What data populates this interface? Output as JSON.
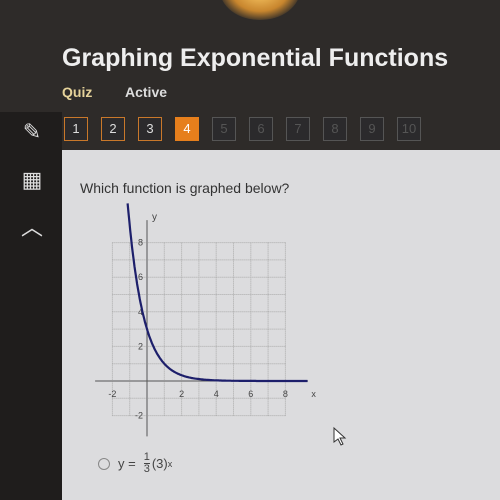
{
  "header": {
    "title": "Graphing Exponential Functions",
    "type": "Quiz",
    "status": "Active"
  },
  "tools": [
    {
      "icon": "pencil-icon"
    },
    {
      "icon": "calculator-icon"
    },
    {
      "icon": "collapse-up-icon"
    }
  ],
  "questions": [
    {
      "label": "1",
      "state": "answered"
    },
    {
      "label": "2",
      "state": "answered"
    },
    {
      "label": "3",
      "state": "answered"
    },
    {
      "label": "4",
      "state": "current"
    },
    {
      "label": "5",
      "state": "locked"
    },
    {
      "label": "6",
      "state": "locked"
    },
    {
      "label": "7",
      "state": "locked"
    },
    {
      "label": "8",
      "state": "locked"
    },
    {
      "label": "9",
      "state": "locked"
    },
    {
      "label": "10",
      "state": "locked"
    }
  ],
  "question": "Which function is graphed below?",
  "graph": {
    "xlabel": "x",
    "ylabel": "y",
    "xlim": [
      -2,
      8
    ],
    "ylim": [
      -2,
      8
    ],
    "xticks": [
      "-2",
      "2",
      "4",
      "6",
      "8"
    ],
    "yticks": [
      "-2",
      "2",
      "4",
      "6",
      "8"
    ],
    "curve": "y = 3(1/3)^x",
    "color": "#1d1f6b"
  },
  "options": [
    {
      "text": "y = 1/3 (3)^x",
      "coef_num": "1",
      "coef_den": "3",
      "base": "(3)",
      "exp": "x",
      "prefix": "y ="
    }
  ]
}
